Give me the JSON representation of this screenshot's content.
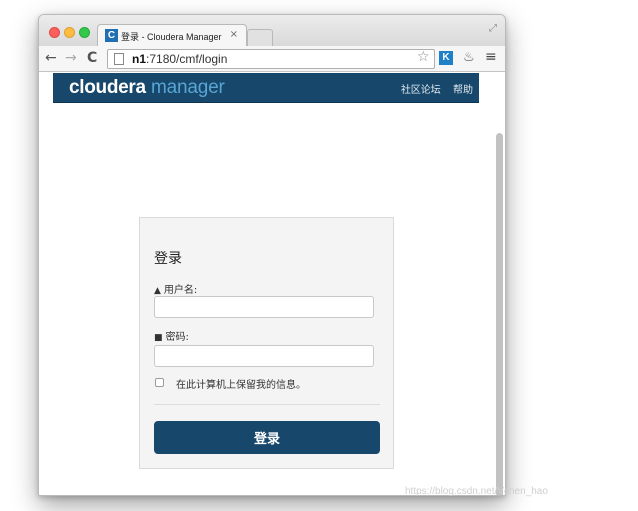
{
  "browser": {
    "tab_title": "登录 - Cloudera Manager",
    "tab_favicon_letter": "C",
    "tab_close": "×",
    "url_host": "n1",
    "url_rest": ":7180/cmf/login",
    "ext_letter": "K"
  },
  "header": {
    "logo_primary": "cloudera",
    "logo_secondary": "manager",
    "links": [
      "社区论坛",
      "帮助"
    ]
  },
  "login": {
    "heading": "登录",
    "username_label": "用户名:",
    "password_label": "密码:",
    "username_value": "",
    "password_value": "",
    "remember_label": "在此计算机上保留我的信息。",
    "submit_label": "登录"
  },
  "watermark": "https://blog.csdn.net/Vchen_hao",
  "colors": {
    "brand_dark": "#17476a",
    "brand_light": "#58a5d6"
  }
}
